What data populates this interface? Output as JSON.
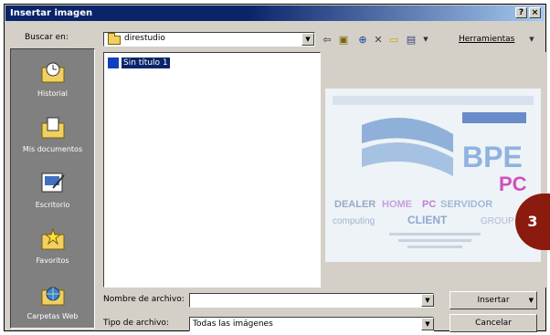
{
  "dialog": {
    "title": "Insertar imagen",
    "title_buttons": [
      "?",
      "×"
    ]
  },
  "lookin": {
    "label": "Buscar en:",
    "value": "direstudio"
  },
  "toolbar": {
    "icons": [
      "back-arrow-icon",
      "up-folder-icon",
      "search-web-icon",
      "delete-icon",
      "new-folder-icon",
      "views-icon"
    ],
    "tools_label": "Herramientas"
  },
  "places": [
    {
      "label": "Historial",
      "icon": "history-icon"
    },
    {
      "label": "Mis documentos",
      "icon": "my-documents-icon"
    },
    {
      "label": "Escritorio",
      "icon": "desktop-icon"
    },
    {
      "label": "Favoritos",
      "icon": "favorites-icon"
    },
    {
      "label": "Carpetas Web",
      "icon": "web-folders-icon"
    }
  ],
  "files": [
    {
      "name": "Sin título 1",
      "selected": true
    }
  ],
  "preview": {
    "logo_text": "BPE",
    "sub_text": "PC",
    "ribbon_words": [
      "DEALER",
      "HOME",
      "PC",
      "SERVIDOR",
      "computing",
      "CLIENT",
      "GROUP"
    ]
  },
  "filename": {
    "label": "Nombre de archivo:",
    "value": ""
  },
  "filetype": {
    "label": "Tipo de archivo:",
    "value": "Todas las imágenes"
  },
  "buttons": {
    "insert": "Insertar",
    "cancel": "Cancelar"
  },
  "badge": {
    "number": "3",
    "color": "#8b1a0f"
  },
  "colors": {
    "title_bar": "#0a246a",
    "face": "#d4d0c8",
    "places_bg": "#808080",
    "selection": "#0a246a"
  }
}
